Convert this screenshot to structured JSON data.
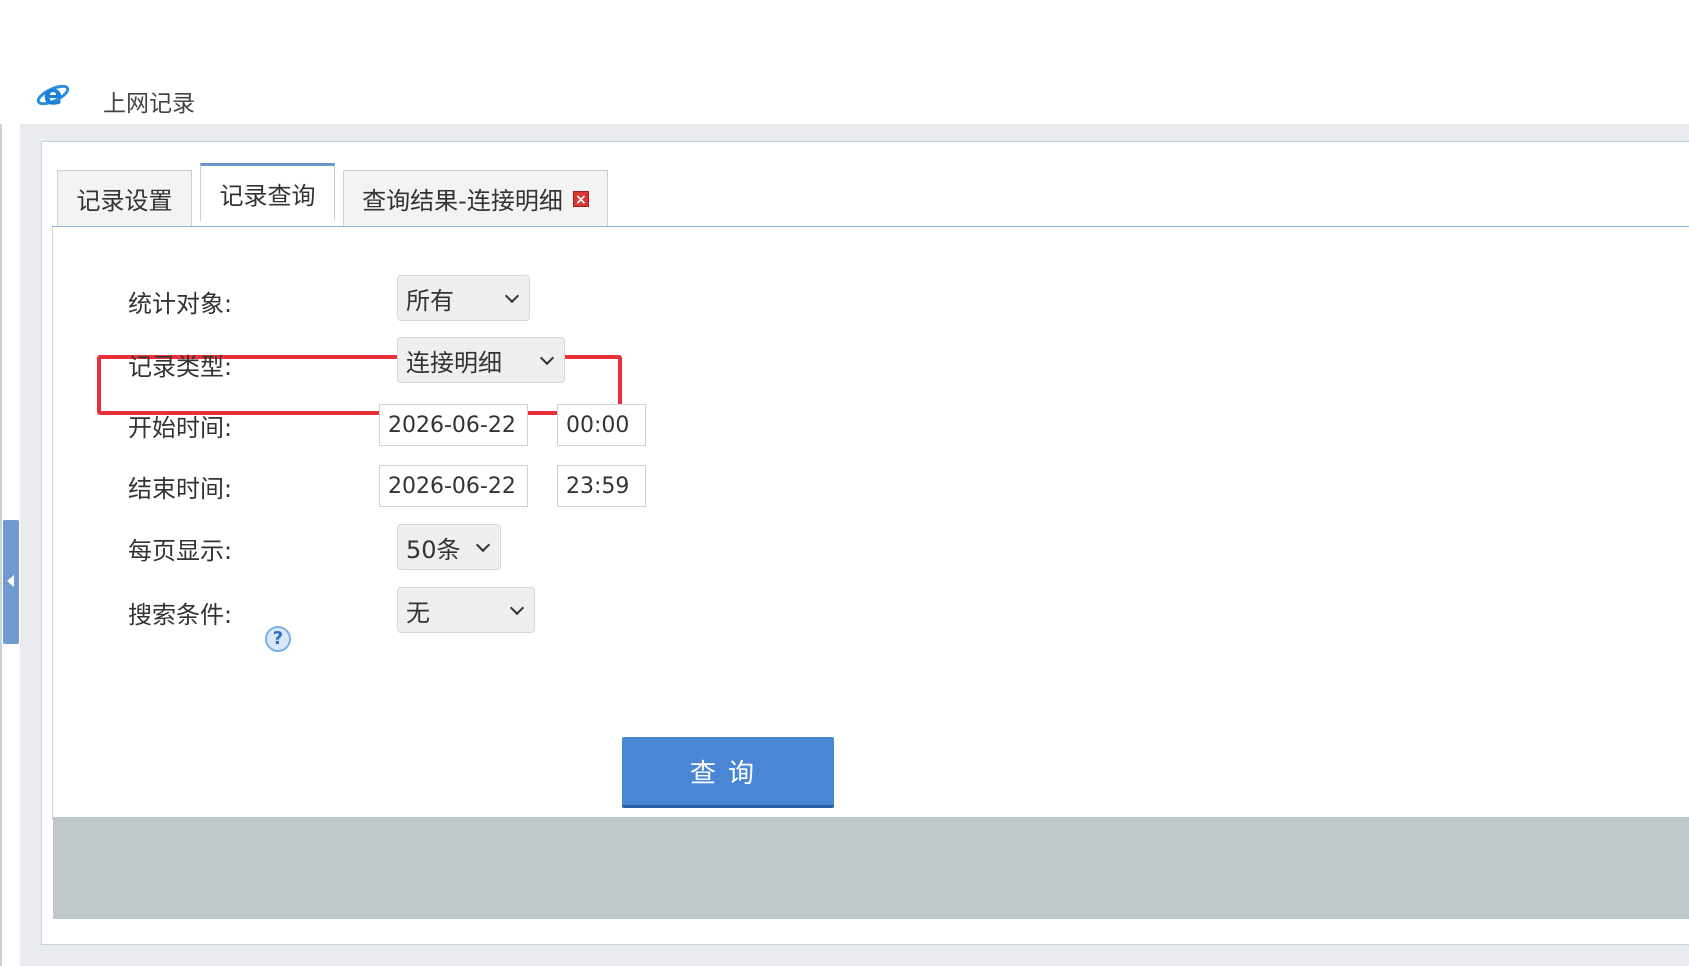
{
  "header": {
    "title": "上网记录",
    "icon": "ie-browser-icon"
  },
  "tabs": [
    {
      "label": "记录设置",
      "active": false
    },
    {
      "label": "记录查询",
      "active": true
    },
    {
      "label": "查询结果-连接明细",
      "active": false,
      "closable": true,
      "close_glyph": "×"
    }
  ],
  "form": {
    "target": {
      "label": "统计对象:",
      "value": "所有"
    },
    "record_type": {
      "label": "记录类型:",
      "value": "连接明细"
    },
    "start_time": {
      "label": "开始时间:",
      "date": "2026-06-22",
      "time": "00:00"
    },
    "end_time": {
      "label": "结束时间:",
      "date": "2026-06-22",
      "time": "23:59"
    },
    "page_size": {
      "label": "每页显示:",
      "value": "50条"
    },
    "search": {
      "label": "搜索条件:",
      "value": "无",
      "help_glyph": "?"
    }
  },
  "query_button": {
    "label": "查询"
  },
  "colors": {
    "accent": "#4a86d6",
    "highlight": "#e8313b",
    "footer": "#bec7c9"
  }
}
